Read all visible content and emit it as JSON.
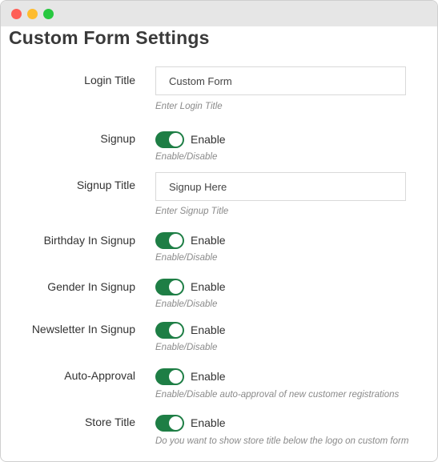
{
  "page_title": "Custom Form Settings",
  "fields": {
    "login_title": {
      "label": "Login Title",
      "value": "Custom Form",
      "hint": "Enter Login Title"
    },
    "signup": {
      "label": "Signup",
      "toggle_label": "Enable",
      "enabled": true,
      "hint": "Enable/Disable"
    },
    "signup_title": {
      "label": "Signup Title",
      "value": "Signup Here",
      "hint": "Enter Signup Title"
    },
    "birthday_in_signup": {
      "label": "Birthday In Signup",
      "toggle_label": "Enable",
      "enabled": true,
      "hint": "Enable/Disable"
    },
    "gender_in_signup": {
      "label": "Gender In Signup",
      "toggle_label": "Enable",
      "enabled": true,
      "hint": "Enable/Disable"
    },
    "newsletter_in_signup": {
      "label": "Newsletter In Signup",
      "toggle_label": "Enable",
      "enabled": true,
      "hint": "Enable/Disable"
    },
    "auto_approval": {
      "label": "Auto-Approval",
      "toggle_label": "Enable",
      "enabled": true,
      "hint": "Enable/Disable auto-approval of new customer registrations"
    },
    "store_title": {
      "label": "Store Title",
      "toggle_label": "Enable",
      "enabled": true,
      "hint": "Do you want to show store title below the logo on custom form"
    }
  },
  "colors": {
    "toggle_on": "#1e7e45",
    "close": "#fe5f57",
    "minimize": "#febc2e",
    "maximize": "#28c840"
  }
}
